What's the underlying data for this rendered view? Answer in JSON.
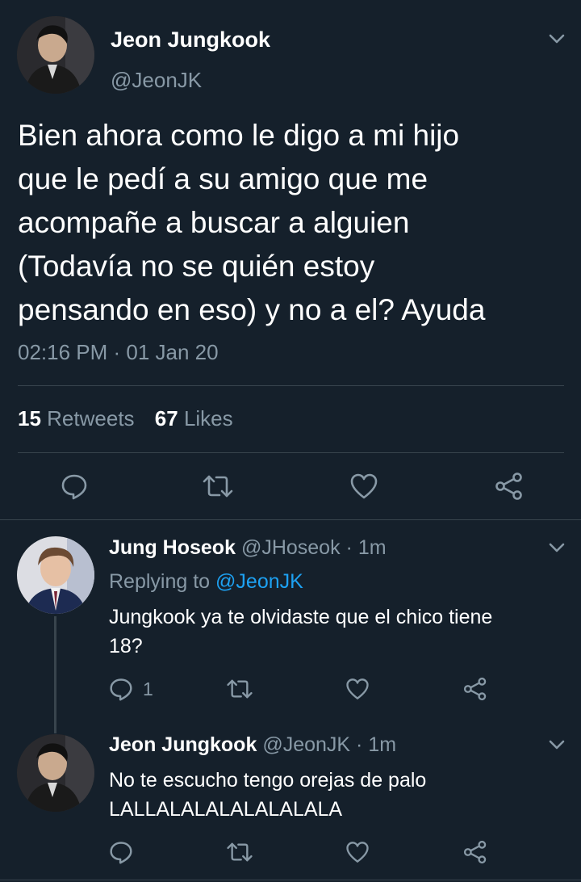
{
  "main_tweet": {
    "name": "Jeon Jungkook",
    "handle": "@JeonJK",
    "text_lines": [
      "Bien ahora como le digo a mi hijo",
      "que le pedí a su amigo que me",
      "acompañe a buscar a alguien",
      "(Todavía no se quién estoy",
      "pensando en eso) y no a el? Ayuda"
    ],
    "timestamp": "02:16 PM · 01 Jan 20",
    "retweets_count": "15",
    "retweets_label": "Retweets",
    "likes_count": "67",
    "likes_label": "Likes"
  },
  "replies": [
    {
      "name": "Jung Hoseok",
      "handle": "@JHoseok",
      "time": "· 1m",
      "replying_label": "Replying to",
      "replying_to": "@JeonJK",
      "text_lines": [
        "Jungkook ya te olvidaste que el chico tiene",
        "18?"
      ],
      "reply_count": "1"
    },
    {
      "name": "Jeon Jungkook",
      "handle": "@JeonJK",
      "time": "· 1m",
      "text_lines": [
        "No te escucho tengo orejas de palo",
        "LALLALALALALALALALA"
      ]
    }
  ],
  "colors": {
    "background": "#15202b",
    "muted": "#8899a6",
    "link": "#1da1f2",
    "divider": "#38444d"
  },
  "icons": [
    "chevron-down-icon",
    "reply-icon",
    "retweet-icon",
    "like-icon",
    "share-icon"
  ]
}
